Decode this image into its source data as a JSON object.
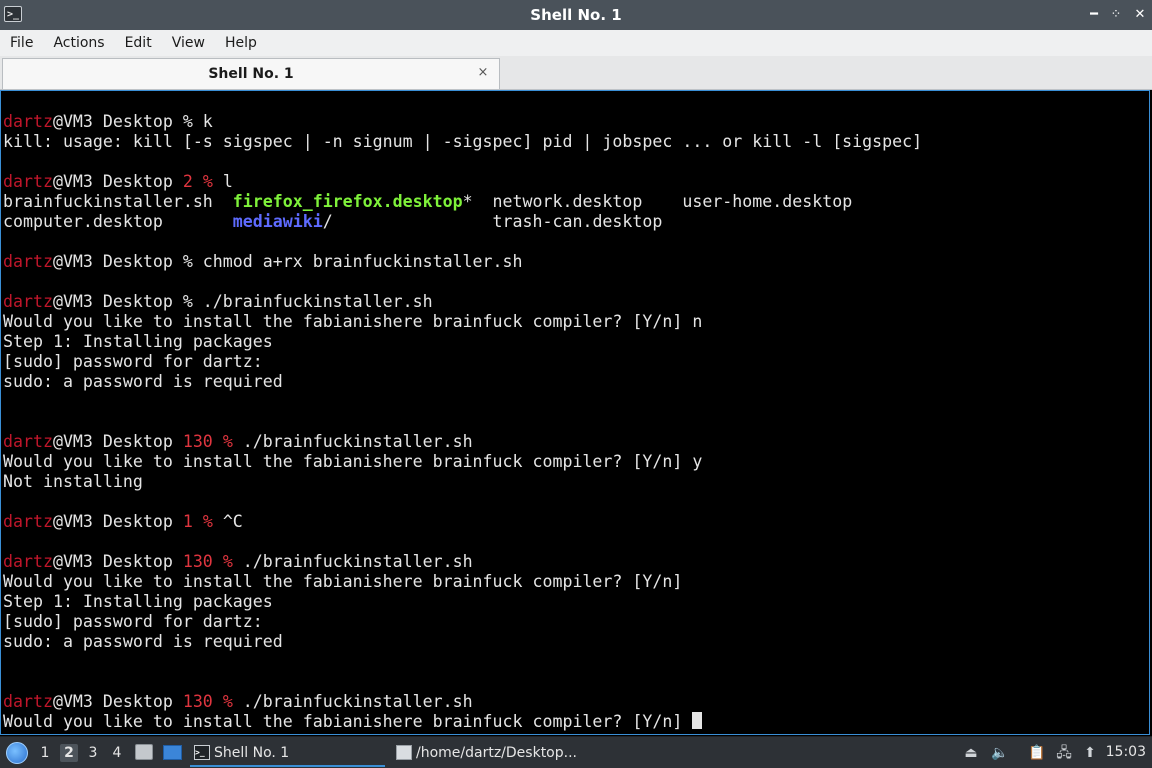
{
  "window": {
    "title": "Shell No. 1",
    "icon": "terminal-icon",
    "controls": [
      "minimize",
      "maximize",
      "restore",
      "close"
    ]
  },
  "menu": [
    "File",
    "Actions",
    "Edit",
    "View",
    "Help"
  ],
  "tabs": [
    {
      "label": "Shell No. 1",
      "close": "×"
    }
  ],
  "colors": {
    "prompt_user": "#c0162b",
    "error_code": "#e0353f",
    "executable": "#7ff23a",
    "directory": "#5e6bff",
    "terminal_bg": "#000000",
    "terminal_fg": "#e5e5e5"
  },
  "terminal": {
    "lines": [
      [
        {
          "t": "dartz",
          "c": "u"
        },
        {
          "t": "@VM3 Desktop % k"
        }
      ],
      [
        {
          "t": "kill: usage: kill [-s sigspec | -n signum | -sigspec] pid | jobspec ... or kill -l [sigspec]"
        }
      ],
      [],
      [
        {
          "t": "dartz",
          "c": "u"
        },
        {
          "t": "@VM3 Desktop "
        },
        {
          "t": "2",
          "c": "err"
        },
        {
          "t": " "
        },
        {
          "t": "%",
          "c": "err"
        },
        {
          "t": " l"
        }
      ],
      [
        {
          "t": "brainfuckinstaller.sh  "
        },
        {
          "t": "firefox_firefox.desktop",
          "c": "exe"
        },
        {
          "t": "*  network.desktop    user-home.desktop"
        }
      ],
      [
        {
          "t": "computer.desktop       "
        },
        {
          "t": "mediawiki",
          "c": "dir"
        },
        {
          "t": "/                trash-can.desktop"
        }
      ],
      [],
      [
        {
          "t": "dartz",
          "c": "u"
        },
        {
          "t": "@VM3 Desktop % chmod a+rx brainfuckinstaller.sh"
        }
      ],
      [],
      [
        {
          "t": "dartz",
          "c": "u"
        },
        {
          "t": "@VM3 Desktop % ./brainfuckinstaller.sh"
        }
      ],
      [
        {
          "t": "Would you like to install the fabianishere brainfuck compiler? [Y/n] n"
        }
      ],
      [
        {
          "t": "Step 1: Installing packages"
        }
      ],
      [
        {
          "t": "[sudo] password for dartz:"
        }
      ],
      [
        {
          "t": "sudo: a password is required"
        }
      ],
      [],
      [],
      [
        {
          "t": "dartz",
          "c": "u"
        },
        {
          "t": "@VM3 Desktop "
        },
        {
          "t": "130",
          "c": "err"
        },
        {
          "t": " "
        },
        {
          "t": "%",
          "c": "err"
        },
        {
          "t": " ./brainfuckinstaller.sh"
        }
      ],
      [
        {
          "t": "Would you like to install the fabianishere brainfuck compiler? [Y/n] y"
        }
      ],
      [
        {
          "t": "Not installing"
        }
      ],
      [],
      [
        {
          "t": "dartz",
          "c": "u"
        },
        {
          "t": "@VM3 Desktop "
        },
        {
          "t": "1",
          "c": "err"
        },
        {
          "t": " "
        },
        {
          "t": "%",
          "c": "err"
        },
        {
          "t": " ^C"
        }
      ],
      [],
      [
        {
          "t": "dartz",
          "c": "u"
        },
        {
          "t": "@VM3 Desktop "
        },
        {
          "t": "130",
          "c": "err"
        },
        {
          "t": " "
        },
        {
          "t": "%",
          "c": "err"
        },
        {
          "t": " ./brainfuckinstaller.sh"
        }
      ],
      [
        {
          "t": "Would you like to install the fabianishere brainfuck compiler? [Y/n]"
        }
      ],
      [
        {
          "t": "Step 1: Installing packages"
        }
      ],
      [
        {
          "t": "[sudo] password for dartz:"
        }
      ],
      [
        {
          "t": "sudo: a password is required"
        }
      ],
      [],
      [],
      [
        {
          "t": "dartz",
          "c": "u"
        },
        {
          "t": "@VM3 Desktop "
        },
        {
          "t": "130",
          "c": "err"
        },
        {
          "t": " "
        },
        {
          "t": "%",
          "c": "err"
        },
        {
          "t": " ./brainfuckinstaller.sh"
        }
      ],
      [
        {
          "t": "Would you like to install the fabianishere brainfuck compiler? [Y/n] "
        },
        {
          "cursor": true
        }
      ]
    ]
  },
  "taskbar": {
    "start_icon": "lxqt-start-icon",
    "workspaces": [
      "1",
      "2",
      "3",
      "4"
    ],
    "active_workspace": "2",
    "quicklaunch": [
      "file-manager-icon",
      "show-desktop-icon"
    ],
    "tasks": [
      {
        "label": "Shell No. 1",
        "icon": "terminal-icon",
        "active": true
      },
      {
        "label": "/home/dartz/Desktop...",
        "icon": "text-editor-icon",
        "active": false
      }
    ],
    "tray": [
      "eject-icon",
      "volume-icon",
      "clipboard-icon",
      "network-icon",
      "update-icon"
    ],
    "clock": "15:03"
  }
}
